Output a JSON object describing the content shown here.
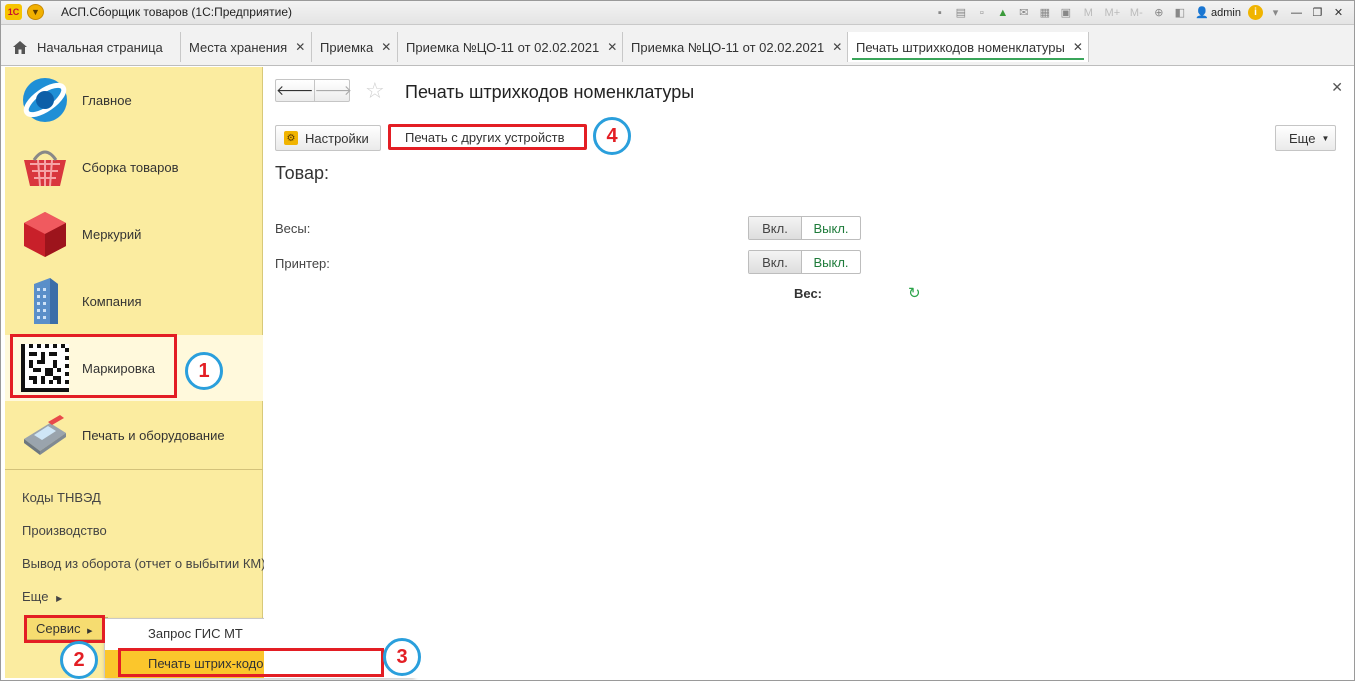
{
  "window": {
    "title": "АСП.Сборщик товаров  (1С:Предприятие)",
    "logo_text": "1С",
    "user": "admin",
    "toolbar_m_labels": [
      "M",
      "M+",
      "M-"
    ]
  },
  "tabs": [
    {
      "label": "Начальная страница",
      "closable": false
    },
    {
      "label": "Места хранения",
      "closable": true
    },
    {
      "label": "Приемка",
      "closable": true
    },
    {
      "label": "Приемка №ЦО-11 от 02.02.2021",
      "closable": true
    },
    {
      "label": "Приемка №ЦО-11 от 02.02.2021",
      "closable": true
    },
    {
      "label": "Печать штрихкодов номенклатуры",
      "closable": true,
      "active": true
    }
  ],
  "tab_close_glyph": "✕",
  "sidebar": {
    "sections": [
      {
        "label": "Главное",
        "icon": "main-logo-icon"
      },
      {
        "label": "Сборка товаров",
        "icon": "basket-icon"
      },
      {
        "label": "Меркурий",
        "icon": "mercury-cube-icon"
      },
      {
        "label": "Компания",
        "icon": "building-icon"
      },
      {
        "label": "Маркировка",
        "icon": "datamatrix-icon",
        "selected": true
      },
      {
        "label": "Печать и оборудование",
        "icon": "pos-terminal-icon"
      }
    ],
    "links": [
      "Коды ТНВЭД",
      "Производство",
      "Вывод из оборота (отчет о выбытии КМ)",
      "Еще"
    ],
    "servis_label": "Сервис"
  },
  "popup_menu": {
    "items": [
      "Запрос ГИС МТ",
      "Печать штрих-кодов номенклатуры"
    ]
  },
  "form": {
    "title": "Печать штрихкодов номенклатуры",
    "buttons": {
      "settings": "Настройки",
      "other_devices": "Печать с других устройств",
      "more": "Еще"
    },
    "tovar_label": "Товар:",
    "fields": [
      {
        "label": "Весы:",
        "on": "Вкл.",
        "off": "Выкл."
      },
      {
        "label": "Принтер:",
        "on": "Вкл.",
        "off": "Выкл."
      }
    ],
    "weight_label": "Вес:"
  },
  "annotations": {
    "markers": [
      "1",
      "2",
      "3",
      "4"
    ],
    "highlight_color": "#e31e24",
    "marker_ring_color": "#2a9fdc"
  },
  "colors": {
    "sidebar_bg": "#fbeca0",
    "accent_green": "#3aa55a",
    "menu_highlight": "#fbc62c"
  }
}
